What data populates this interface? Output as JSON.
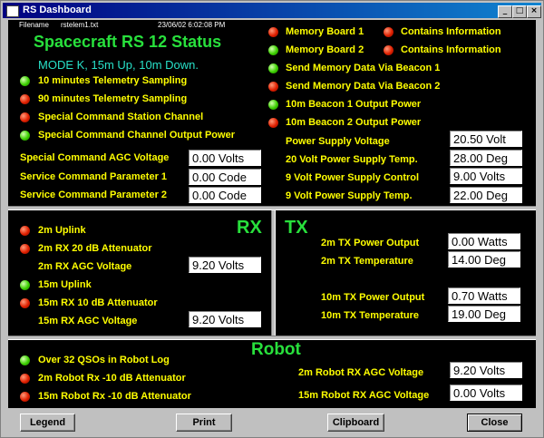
{
  "window": {
    "title": "RS Dashboard"
  },
  "header": {
    "filename_label": "Filename",
    "filename": "rstelem1.txt",
    "datetime": "23/06/02 6:02:08 PM",
    "title": "Spacecraft RS 12 Status",
    "mode": "MODE K, 15m Up, 10m Down."
  },
  "status_left": [
    {
      "label": "10 minutes  Telemetry Sampling",
      "color": "green"
    },
    {
      "label": "90 minutes  Telemetry Sampling",
      "color": "red"
    },
    {
      "label": "Special Command Station Channel",
      "color": "red"
    },
    {
      "label": "Special Command Channel Output Power",
      "color": "green"
    }
  ],
  "params_left": [
    {
      "label": "Special Command AGC Voltage",
      "value": "0.00 Volts"
    },
    {
      "label": "Service Command Parameter 1",
      "value": "0.00 Code"
    },
    {
      "label": "Service Command Parameter 2",
      "value": "0.00 Code"
    }
  ],
  "memory": [
    {
      "label": "Memory Board 1",
      "color": "red",
      "info_label": "Contains Information",
      "info_color": "red"
    },
    {
      "label": "Memory Board 2",
      "color": "green",
      "info_label": "Contains Information",
      "info_color": "red"
    }
  ],
  "status_right": [
    {
      "label": "Send Memory Data Via Beacon 1",
      "color": "green"
    },
    {
      "label": "Send Memory Data Via Beacon 2",
      "color": "red"
    },
    {
      "label": "10m Beacon 1 Output Power",
      "color": "green"
    },
    {
      "label": "10m Beacon 2 Output Power",
      "color": "red"
    }
  ],
  "params_right": [
    {
      "label": "Power Supply Voltage",
      "value": "20.50 Volt"
    },
    {
      "label": "20 Volt Power Supply Temp.",
      "value": "28.00 Deg"
    },
    {
      "label": "9 Volt Power Supply Control",
      "value": "9.00 Volts"
    },
    {
      "label": "9 Volt Power Supply Temp.",
      "value": "22.00 Deg"
    }
  ],
  "rx": {
    "heading": "RX",
    "items": [
      {
        "label": "2m Uplink",
        "color": "red"
      },
      {
        "label": "2m RX 20 dB Attenuator",
        "color": "red"
      },
      {
        "label": "15m Uplink",
        "color": "green"
      },
      {
        "label": "15m RX 10 dB Attenuator",
        "color": "red"
      }
    ],
    "agc": [
      {
        "label": "2m RX AGC Voltage",
        "value": "9.20 Volts"
      },
      {
        "label": "15m RX AGC Voltage",
        "value": "9.20 Volts"
      }
    ]
  },
  "tx": {
    "heading": "TX",
    "params": [
      {
        "label": "2m TX Power Output",
        "value": "0.00 Watts"
      },
      {
        "label": "2m TX Temperature",
        "value": "14.00 Deg"
      },
      {
        "label": "10m TX Power Output",
        "value": "0.70 Watts"
      },
      {
        "label": "10m TX Temperature",
        "value": "19.00 Deg"
      }
    ]
  },
  "robot": {
    "heading": "Robot",
    "items": [
      {
        "label": "Over 32 QSOs in Robot Log",
        "color": "green"
      },
      {
        "label": "2m Robot Rx -10 dB Attenuator",
        "color": "red"
      },
      {
        "label": "15m Robot Rx -10 dB Attenuator",
        "color": "red"
      }
    ],
    "params": [
      {
        "label": "2m Robot RX AGC Voltage",
        "value": "9.20 Volts"
      },
      {
        "label": "15m Robot RX AGC Voltage",
        "value": "0.00 Volts"
      }
    ]
  },
  "buttons": {
    "legend": "Legend",
    "print": "Print",
    "clipboard": "Clipboard",
    "close": "Close"
  },
  "colors": {
    "label": "#ffff00",
    "heading": "#28e03c",
    "mode": "#28e03c",
    "background": "#000000"
  }
}
